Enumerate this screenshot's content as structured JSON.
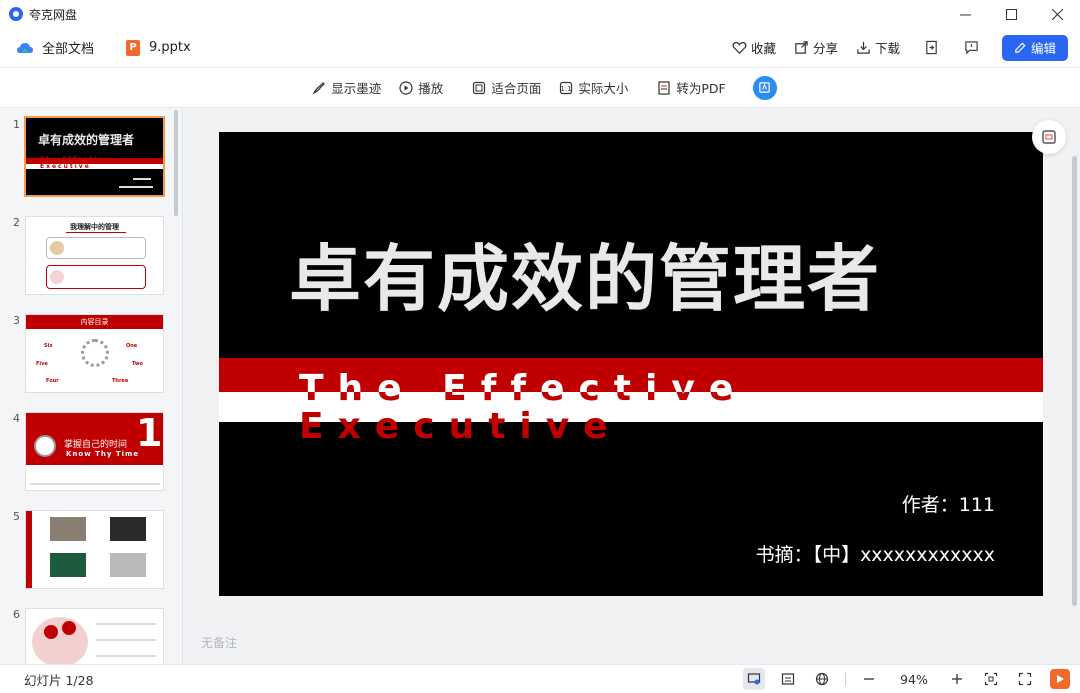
{
  "window": {
    "app_title": "夸克网盘"
  },
  "header": {
    "all_docs_label": "全部文档",
    "file_name": "9.pptx",
    "file_icon_letter": "P",
    "actions": {
      "favorite": "收藏",
      "share": "分享",
      "download": "下载"
    },
    "edit_label": "编辑"
  },
  "toolbar": {
    "show_ink": "显示墨迹",
    "play": "播放",
    "fit_page": "适合页面",
    "actual_size": "实际大小",
    "to_pdf": "转为PDF"
  },
  "thumbnails": [
    {
      "num": "1",
      "title": "卓有成效的管理者",
      "subtitle": "The Effective Executive"
    },
    {
      "num": "2",
      "title": "我理解中的管理"
    },
    {
      "num": "3",
      "title": "内容目录",
      "items": [
        "Six",
        "One",
        "Five",
        "Two",
        "Four",
        "Three"
      ]
    },
    {
      "num": "4",
      "title": "掌握自己的时间",
      "subtitle": "Know Thy Time",
      "big_num": "1"
    },
    {
      "num": "5"
    },
    {
      "num": "6"
    }
  ],
  "slide": {
    "title": "卓有成效的管理者",
    "subtitle": "The Effective Executive",
    "author": "作者：111",
    "book": "书摘：【中】xxxxxxxxxxxx"
  },
  "notes_placeholder": "无备注",
  "status": {
    "slide_count": "幻灯片 1/28",
    "zoom": "94%"
  },
  "colors": {
    "accent": "#2a66f2",
    "slide_red": "#c00000",
    "ppt_orange": "#f06b2b"
  }
}
